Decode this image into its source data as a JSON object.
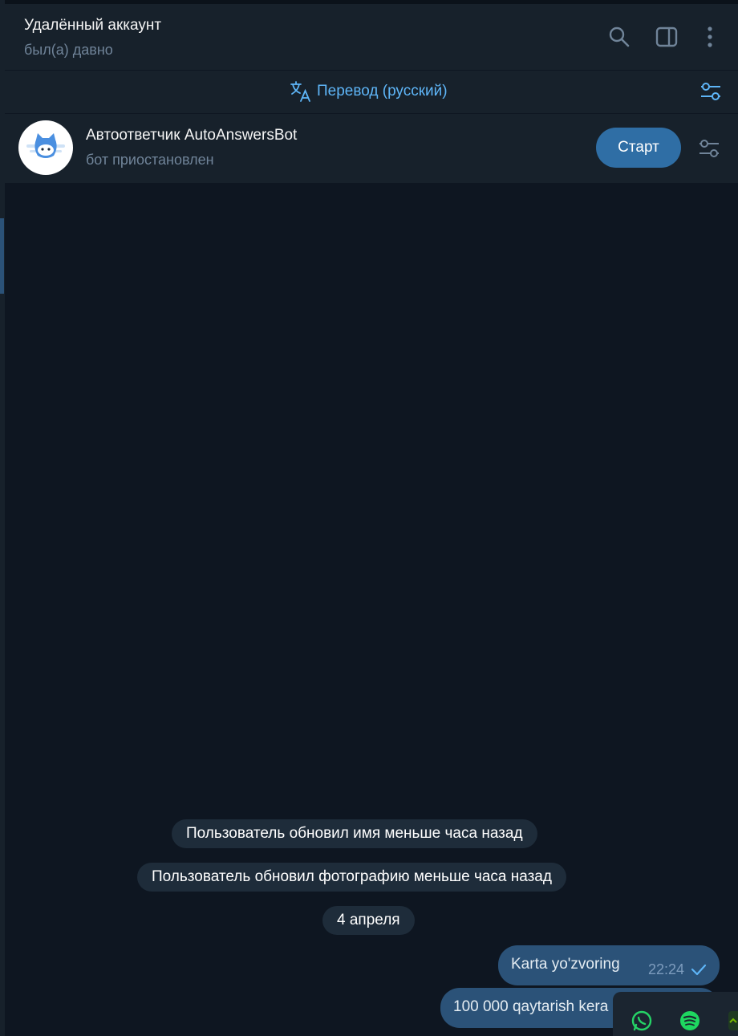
{
  "header": {
    "title": "Удалённый аккаунт",
    "subtitle": "был(а) давно",
    "icons": [
      "search-icon",
      "sidebar-toggle-icon",
      "more-vertical-icon"
    ]
  },
  "translate_bar": {
    "label": "Перевод (русский)",
    "icon": "translate-icon",
    "settings_icon": "sliders-icon"
  },
  "bot_bar": {
    "name": "Автоответчик AutoAnswersBot",
    "status": "бот приостановлен",
    "start_label": "Старт",
    "settings_icon": "sliders-icon"
  },
  "messages": {
    "service_1": "Пользователь обновил имя меньше часа назад",
    "service_2": "Пользователь обновил фотографию меньше часа назад",
    "date": "4 апреля",
    "msg_1": {
      "text": "Karta yo'zvoring",
      "time": "22:24"
    },
    "msg_2": {
      "text": "100 000 qaytarish kera"
    }
  },
  "colors": {
    "background": "#0e1621",
    "panel": "#17212b",
    "accent": "#5eb5f7",
    "outgoing_bubble": "#2b5278",
    "start_button": "#2f6ea5"
  },
  "dock": {
    "icons": [
      "whatsapp-icon",
      "spotify-icon",
      "app-icon"
    ]
  }
}
